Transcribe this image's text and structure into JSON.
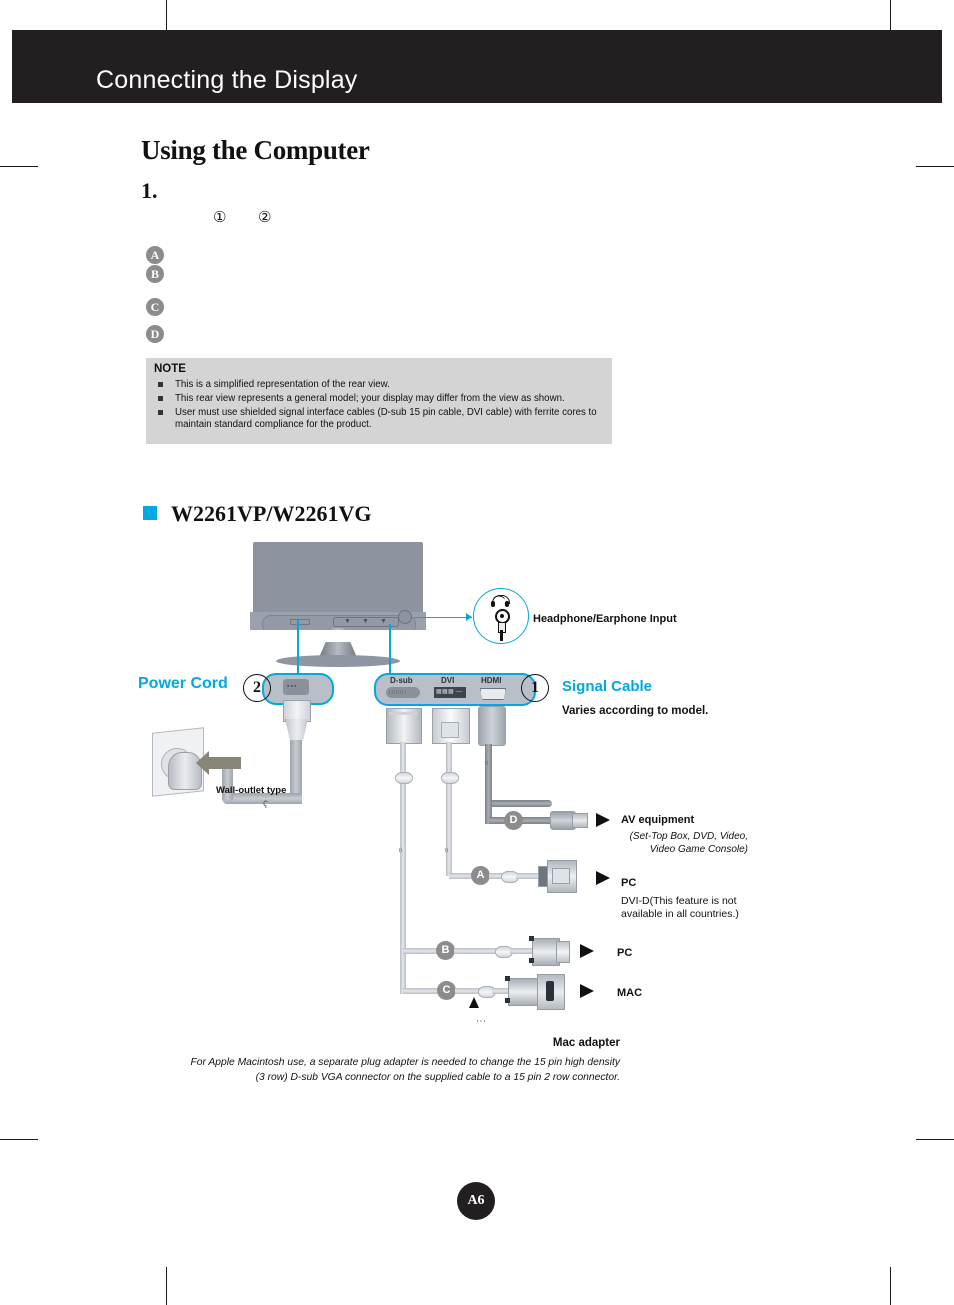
{
  "header": {
    "title": "Connecting the Display"
  },
  "section": {
    "title": "Using the Computer",
    "step_number": "1.",
    "circled_numbers": [
      "①",
      "②"
    ],
    "badges": [
      "A",
      "B",
      "C",
      "D"
    ]
  },
  "note": {
    "title": "NOTE",
    "items": [
      "This is a simplified representation of the rear view.",
      "This rear view represents a general model; your display may differ from the view as shown.",
      "User must use shielded signal interface cables (D-sub 15 pin cable, DVI cable) with ferrite cores to maintain standard compliance for the product."
    ]
  },
  "model": {
    "bullet_color": "#00a9e0",
    "name": "W2261VP/W2261VG"
  },
  "diagram": {
    "headphone_callout": {
      "label": "Headphone/Earphone Input",
      "icons": [
        "headphone-icon",
        "audio-jack-socket-icon",
        "audio-plug-icon"
      ]
    },
    "power": {
      "label": "Power Cord",
      "number": "2",
      "wall_outlet_label": "Wall-outlet type",
      "cable_break": "ʕ"
    },
    "signal": {
      "label": "Signal Cable",
      "sublabel": "Varies according to model.",
      "number": "1",
      "ports": [
        "D-sub",
        "DVI",
        "HDMI"
      ]
    },
    "connections": [
      {
        "badge": "D",
        "title": "AV equipment",
        "italic": "(Set-Top Box, DVD, Video,\nVideo Game Console)",
        "sub": ""
      },
      {
        "badge": "A",
        "title": "PC",
        "italic": "",
        "sub": "DVI-D(This feature is not\navailable in all countries.)"
      },
      {
        "badge": "B",
        "title": "PC",
        "italic": "",
        "sub": ""
      },
      {
        "badge": "C",
        "title": "MAC",
        "italic": "",
        "sub": ""
      }
    ],
    "mac_adapter": {
      "title": "Mac adapter",
      "caption": "For Apple Macintosh use, a  separate plug adapter is needed to change the 15 pin high density (3 row) D-sub VGA connector on the supplied cable to a 15 pin  2 row connector."
    }
  },
  "footer": {
    "page": "A6"
  }
}
